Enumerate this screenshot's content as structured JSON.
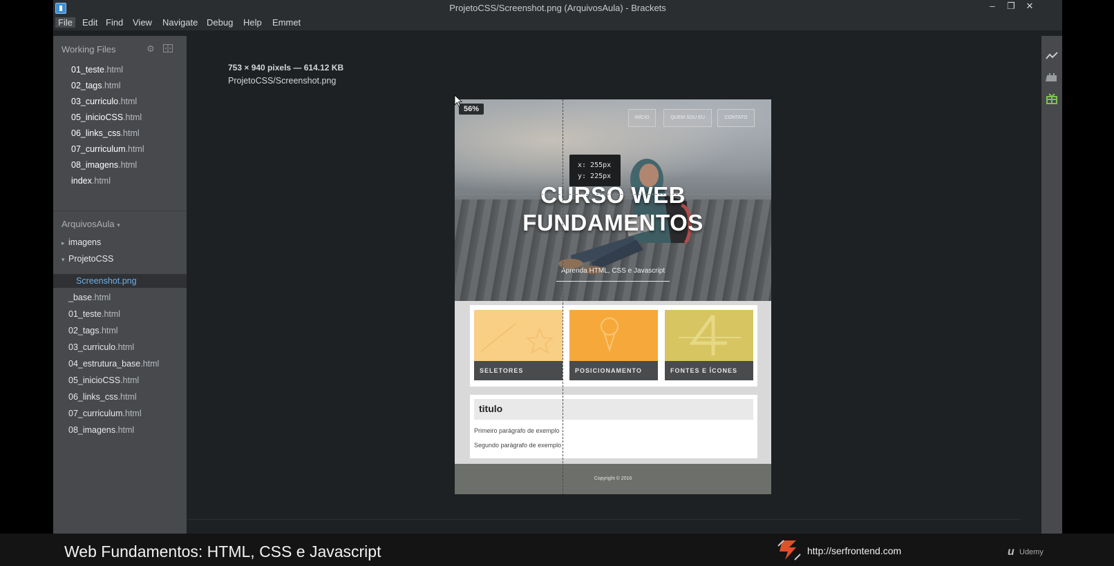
{
  "window": {
    "title": "ProjetoCSS/Screenshot.png (ArquivosAula) - Brackets",
    "controls": {
      "minimize": "–",
      "restore": "❐",
      "close": "✕"
    }
  },
  "menu": {
    "items": [
      "File",
      "Edit",
      "Find",
      "View",
      "Navigate",
      "Debug",
      "Help",
      "Emmet"
    ],
    "active": "File"
  },
  "sidebar": {
    "working_files_label": "Working Files",
    "working_files": [
      {
        "name": "01_teste",
        "ext": ".html"
      },
      {
        "name": "02_tags",
        "ext": ".html"
      },
      {
        "name": "03_curriculo",
        "ext": ".html"
      },
      {
        "name": "05_inicioCSS",
        "ext": ".html"
      },
      {
        "name": "06_links_css",
        "ext": ".html"
      },
      {
        "name": "07_curriculum",
        "ext": ".html"
      },
      {
        "name": "08_imagens",
        "ext": ".html"
      },
      {
        "name": "index",
        "ext": ".html"
      }
    ],
    "project_label": "ArquivosAula",
    "tree": {
      "folder_imagens": "imagens",
      "folder_projetocss": "ProjetoCSS",
      "selected_file": "Screenshot.png",
      "files": [
        {
          "name": "_base",
          "ext": ".html"
        },
        {
          "name": "01_teste",
          "ext": ".html"
        },
        {
          "name": "02_tags",
          "ext": ".html"
        },
        {
          "name": "03_curriculo",
          "ext": ".html"
        },
        {
          "name": "04_estrutura_base",
          "ext": ".html"
        },
        {
          "name": "05_inicioCSS",
          "ext": ".html"
        },
        {
          "name": "06_links_css",
          "ext": ".html"
        },
        {
          "name": "07_curriculum",
          "ext": ".html"
        },
        {
          "name": "08_imagens",
          "ext": ".html"
        }
      ]
    }
  },
  "image_view": {
    "dimensions": "753 × 940 pixels — 614.12 KB",
    "path": "ProjetoCSS/Screenshot.png",
    "zoom": "56%",
    "cursor_x": "x: 255px",
    "cursor_y": "y: 225px"
  },
  "preview": {
    "nav": [
      "INÍCIO",
      "QUEM SOU EU",
      "CONTATO"
    ],
    "hero_line1": "CURSO WEB",
    "hero_line2": "FUNDAMENTOS",
    "hero_sub": "Aprenda HTML, CSS e Javascript",
    "cards": [
      "SELETORES",
      "POSICIONAMENTO",
      "FONTES E ÍCONES"
    ],
    "content_title": "titulo",
    "paragraph1": "Primeiro parágrafo de exemplo",
    "paragraph2": "Segundo parágrafo de exemplo",
    "footer": "Copyright © 2016"
  },
  "banner": {
    "course_title": "Web Fundamentos: HTML, CSS e Javascript",
    "url": "http://serfrontend.com",
    "udemy": "Udemy"
  },
  "colors": {
    "sidebar_bg": "#47494c",
    "editor_bg": "#1e2123",
    "selected_file": "#6fb1e9",
    "card1": "#f9cf86",
    "card2": "#f6a93a",
    "card3": "#d6c560"
  }
}
